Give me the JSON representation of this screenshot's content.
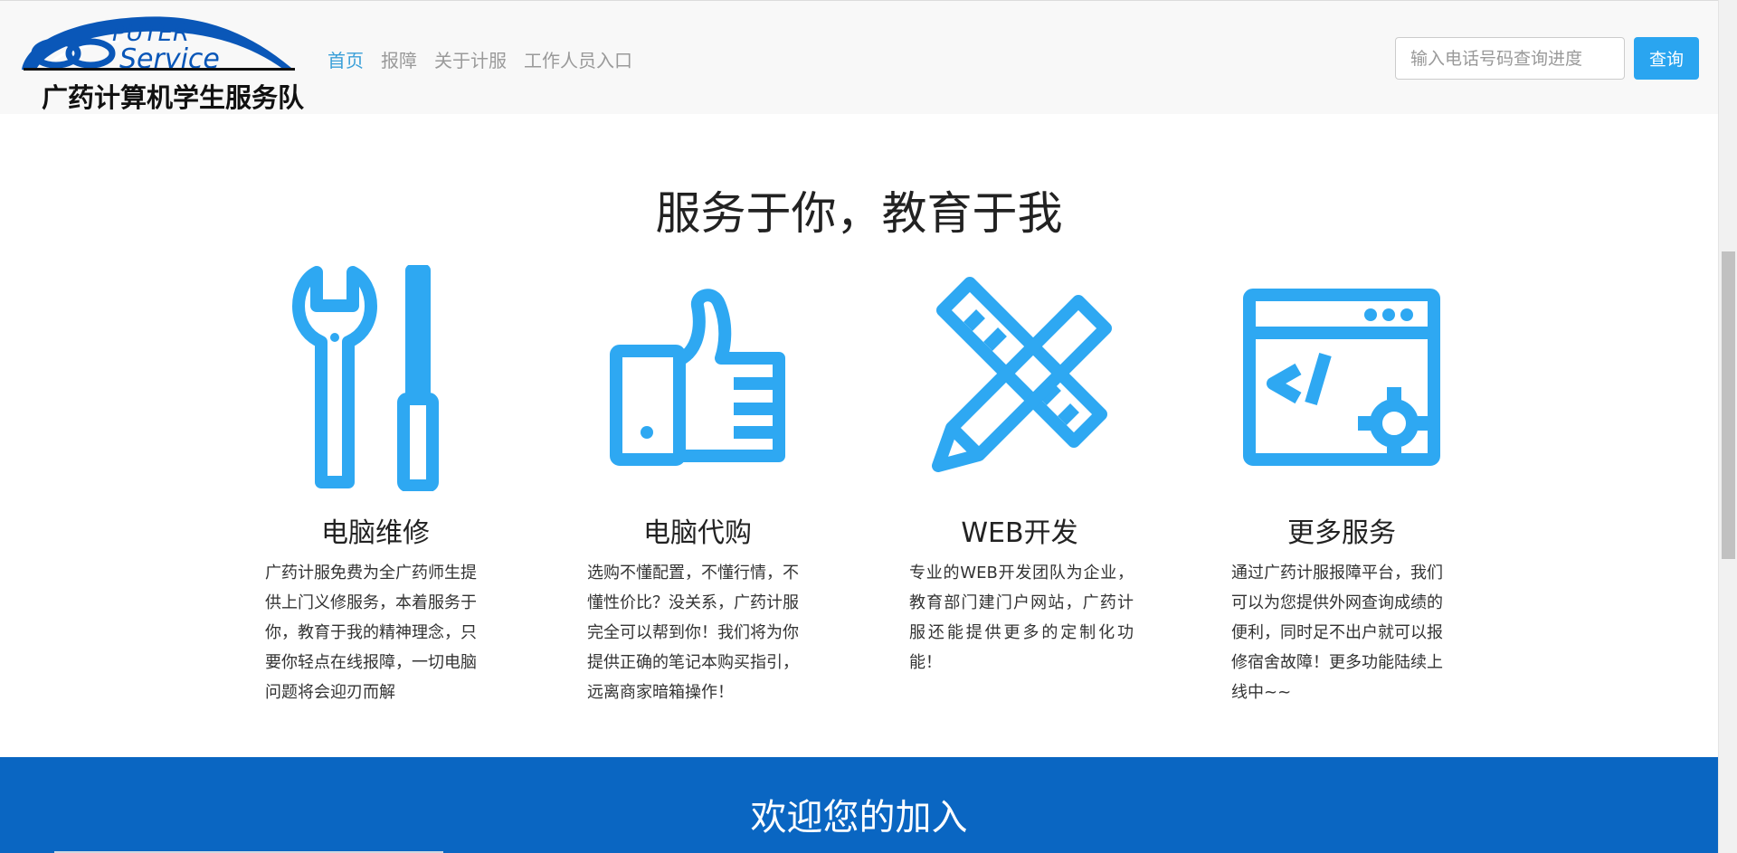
{
  "navbar": {
    "logo_text_1": "CO",
    "logo_text_2": "PUTER",
    "logo_text_3": "Service",
    "logo_cn": "广药计算机学生服务队",
    "links": [
      {
        "label": "首页",
        "active": true
      },
      {
        "label": "报障",
        "active": false
      },
      {
        "label": "关于计服",
        "active": false
      },
      {
        "label": "工作人员入口",
        "active": false
      }
    ],
    "search_placeholder": "输入电话号码查询进度",
    "search_button": "查询"
  },
  "main": {
    "heading": "服务于你，教育于我",
    "features": [
      {
        "icon": "wrench-screwdriver-icon",
        "title": "电脑维修",
        "desc": "广药计服免费为全广药师生提供上门义修服务，本着服务于你，教育于我的精神理念，只要你轻点在线报障，一切电脑问题将会迎刃而解"
      },
      {
        "icon": "thumbs-up-icon",
        "title": "电脑代购",
        "desc": "选购不懂配置，不懂行情，不懂性价比？没关系，广药计服完全可以帮到你！我们将为你提供正确的笔记本购买指引，远离商家暗箱操作！"
      },
      {
        "icon": "ruler-pencil-icon",
        "title": "WEB开发",
        "desc": "专业的WEB开发团队为企业，教育部门建门户网站，广药计服还能提供更多的定制化功能！"
      },
      {
        "icon": "code-window-gear-icon",
        "title": "更多服务",
        "desc": "通过广药计服报障平台，我们可以为您提供外网查询成绩的便利，同时足不出户就可以报修宿舍故障！更多功能陆续上线中~~"
      }
    ]
  },
  "band": {
    "title": "欢迎您的加入"
  },
  "colors": {
    "accent": "#2aa5f0",
    "icon": "#2ea8f2",
    "band": "#0a66c2",
    "nav_active": "#3a9fd8"
  }
}
